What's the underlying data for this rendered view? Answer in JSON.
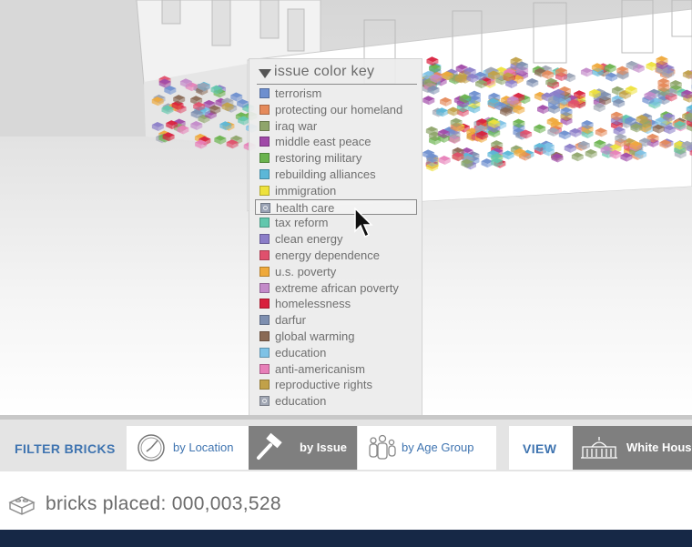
{
  "key": {
    "title": "issue color key",
    "selected_index": 7,
    "items": [
      {
        "label": "terrorism",
        "color": "#6e8fcf"
      },
      {
        "label": "protecting our homeland",
        "color": "#e58a5b"
      },
      {
        "label": "iraq war",
        "color": "#8fa56b"
      },
      {
        "label": "middle east peace",
        "color": "#a04aa8"
      },
      {
        "label": "restoring military",
        "color": "#6ab34e"
      },
      {
        "label": "rebuilding alliances",
        "color": "#5bb7d8"
      },
      {
        "label": "immigration",
        "color": "#eee23c"
      },
      {
        "label": "health care",
        "color": "#9aa3b5"
      },
      {
        "label": "tax reform",
        "color": "#62c7ad"
      },
      {
        "label": "clean energy",
        "color": "#8b7dc8"
      },
      {
        "label": "energy dependence",
        "color": "#e0506d"
      },
      {
        "label": "u.s. poverty",
        "color": "#efa93b"
      },
      {
        "label": "extreme african poverty",
        "color": "#c38ac9"
      },
      {
        "label": "homelessness",
        "color": "#d8203d"
      },
      {
        "label": "darfur",
        "color": "#7e8fb0"
      },
      {
        "label": "global warming",
        "color": "#8a6a55"
      },
      {
        "label": "education",
        "color": "#7ec2e6"
      },
      {
        "label": "anti-americanism",
        "color": "#e77fb8"
      },
      {
        "label": "reproductive rights",
        "color": "#c1a149"
      },
      {
        "label": "education",
        "color": "#a1a7b4"
      }
    ]
  },
  "toolbar": {
    "filter_label": "FILTER BRICKS",
    "tabs": [
      {
        "label": "by Location",
        "icon": "compass-icon"
      },
      {
        "label": "by Issue",
        "icon": "gavel-icon",
        "active": true
      },
      {
        "label": "by Age Group",
        "icon": "people-icon"
      }
    ],
    "view_label": "VIEW",
    "view_option": {
      "label": "White House",
      "icon": "white-house-icon"
    }
  },
  "status": {
    "label": "bricks placed:",
    "count": "000,003,528",
    "icon": "brick-icon"
  }
}
